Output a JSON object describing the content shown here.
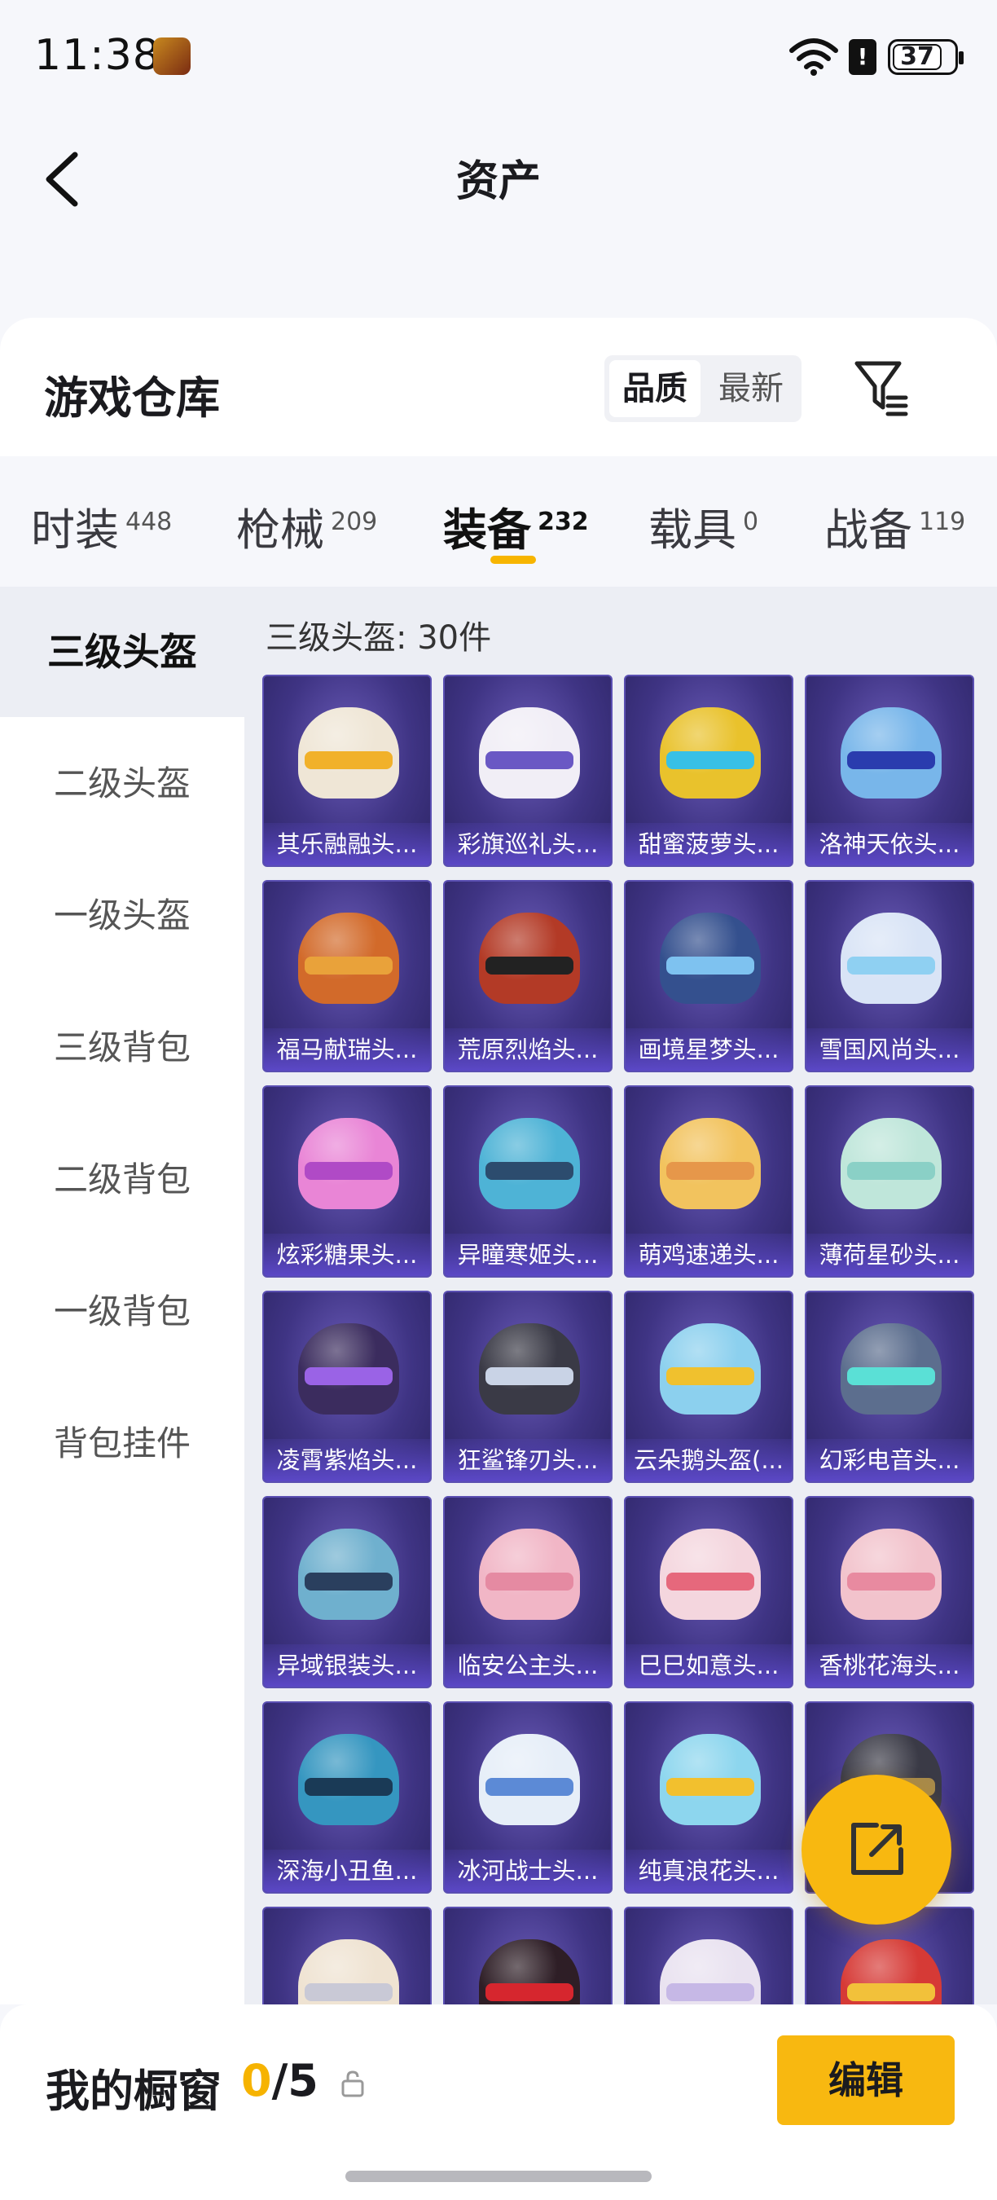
{
  "status_bar": {
    "time": "11:38",
    "battery": "37"
  },
  "header": {
    "title": "资产"
  },
  "warehouse": {
    "title": "游戏仓库",
    "sort_options": [
      "品质",
      "最新"
    ]
  },
  "tabs": [
    {
      "label": "时装",
      "count": "448"
    },
    {
      "label": "枪械",
      "count": "209"
    },
    {
      "label": "装备",
      "count": "232"
    },
    {
      "label": "载具",
      "count": "0"
    },
    {
      "label": "战备",
      "count": "119"
    }
  ],
  "sidebar": {
    "items": [
      "三级头盔",
      "二级头盔",
      "一级头盔",
      "三级背包",
      "二级背包",
      "一级背包",
      "背包挂件"
    ]
  },
  "section": {
    "title": "三级头盔: 30件"
  },
  "items": [
    {
      "name": "其乐融融头...",
      "color": "#efe6d6",
      "visor": "#f1b12a"
    },
    {
      "name": "彩旗巡礼头...",
      "color": "#f1eef6",
      "visor": "#6a58c4"
    },
    {
      "name": "甜蜜菠萝头...",
      "color": "#e9c22c",
      "visor": "#38c0e6"
    },
    {
      "name": "洛神天依头...",
      "color": "#78b6ea",
      "visor": "#2a3cae"
    },
    {
      "name": "福马献瑞头...",
      "color": "#d26a2a",
      "visor": "#e9a23a"
    },
    {
      "name": "荒原烈焰头...",
      "color": "#b33a26",
      "visor": "#222222"
    },
    {
      "name": "画境星梦头...",
      "color": "#34508e",
      "visor": "#7ec2f0"
    },
    {
      "name": "雪国风尚头...",
      "color": "#d9e4f6",
      "visor": "#8fd0f2"
    },
    {
      "name": "炫彩糖果头...",
      "color": "#e985d6",
      "visor": "#b04ac6"
    },
    {
      "name": "异瞳寒姬头...",
      "color": "#4eb3d6",
      "visor": "#2c4c6e"
    },
    {
      "name": "萌鸡速递头...",
      "color": "#f2c35e",
      "visor": "#e6974a"
    },
    {
      "name": "薄荷星砂头...",
      "color": "#bfe6da",
      "visor": "#8ad0c6"
    },
    {
      "name": "凌霄紫焰头...",
      "color": "#3b2c5e",
      "visor": "#9a63e6"
    },
    {
      "name": "狂鲨锋刃头...",
      "color": "#3a3a46",
      "visor": "#c9d3e6"
    },
    {
      "name": "云朵鹅头盔(...",
      "color": "#8cd0ee",
      "visor": "#f0c12e"
    },
    {
      "name": "幻彩电音头...",
      "color": "#5c6e8e",
      "visor": "#5ae0d6"
    },
    {
      "name": "异域银装头...",
      "color": "#6fb0ce",
      "visor": "#2a3f5e"
    },
    {
      "name": "临安公主头...",
      "color": "#f1b6c6",
      "visor": "#e58aa2"
    },
    {
      "name": "巳巳如意头...",
      "color": "#f4d6de",
      "visor": "#e6687c"
    },
    {
      "name": "香桃花海头...",
      "color": "#f2c3cc",
      "visor": "#e88aa0"
    },
    {
      "name": "深海小丑鱼...",
      "color": "#3596c0",
      "visor": "#1a3a56"
    },
    {
      "name": "冰河战士头...",
      "color": "#e6eef8",
      "visor": "#5c8ad6"
    },
    {
      "name": "纯真浪花头...",
      "color": "#8dd6ee",
      "visor": "#f2c02e"
    },
    {
      "name": "",
      "color": "#3a3a46",
      "visor": "#a88a4a"
    },
    {
      "name": "",
      "color": "#efe3d2",
      "visor": "#c9c9d6"
    },
    {
      "name": "",
      "color": "#2e1e26",
      "visor": "#d6262e"
    },
    {
      "name": "",
      "color": "#e9e2f0",
      "visor": "#c6b8e6"
    },
    {
      "name": "",
      "color": "#d63a36",
      "visor": "#f2c13a"
    }
  ],
  "bottom": {
    "label": "我的橱窗",
    "current": "0",
    "total": "/5",
    "edit_label": "编辑"
  }
}
